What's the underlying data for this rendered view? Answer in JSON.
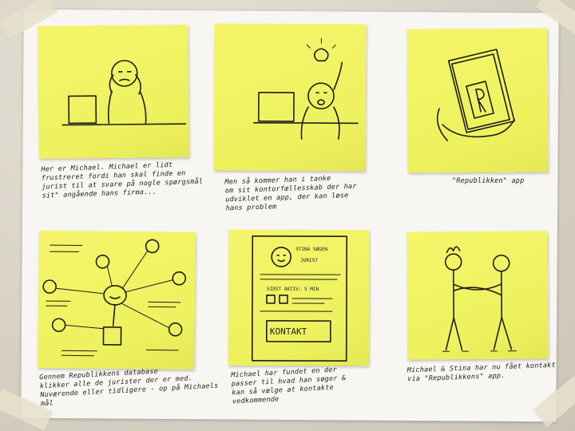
{
  "captions": {
    "c1": "Her er Michael. Michael er lidt\nfrustreret fordi han skal finde en\njurist til at svare på nogle spørgsmål\nsit\" angående hans firma...",
    "c2": "Men så kommer han i tanke\nom sit kontorfællesskab der har\nudviklet en app, der kan løse\nhans problem",
    "c3": "\"Republikken\" app",
    "c4": "Gennem Republikkens database\nklikker alle de jurister der er med.\nNuværende eller tidligere - op på Michaels mål",
    "c5": "Michael har fundet en der\npasser til hvad han søger &\nkan så vælge at kontakte\nvedkommende",
    "c6": "Michael & Stina har nu fået kontakt\nvia \"Republikkens\" app."
  },
  "sketch_text": {
    "profile_name": "STINA SØGEN",
    "profile_role": "JURIST",
    "profile_status": "SIDST AKTIV: 5 MIN",
    "contact_button": "KONTAKT"
  },
  "colors": {
    "note_yellow": "#f1f35f",
    "paper": "#f7f6f2",
    "ink": "#1d1d1d"
  }
}
